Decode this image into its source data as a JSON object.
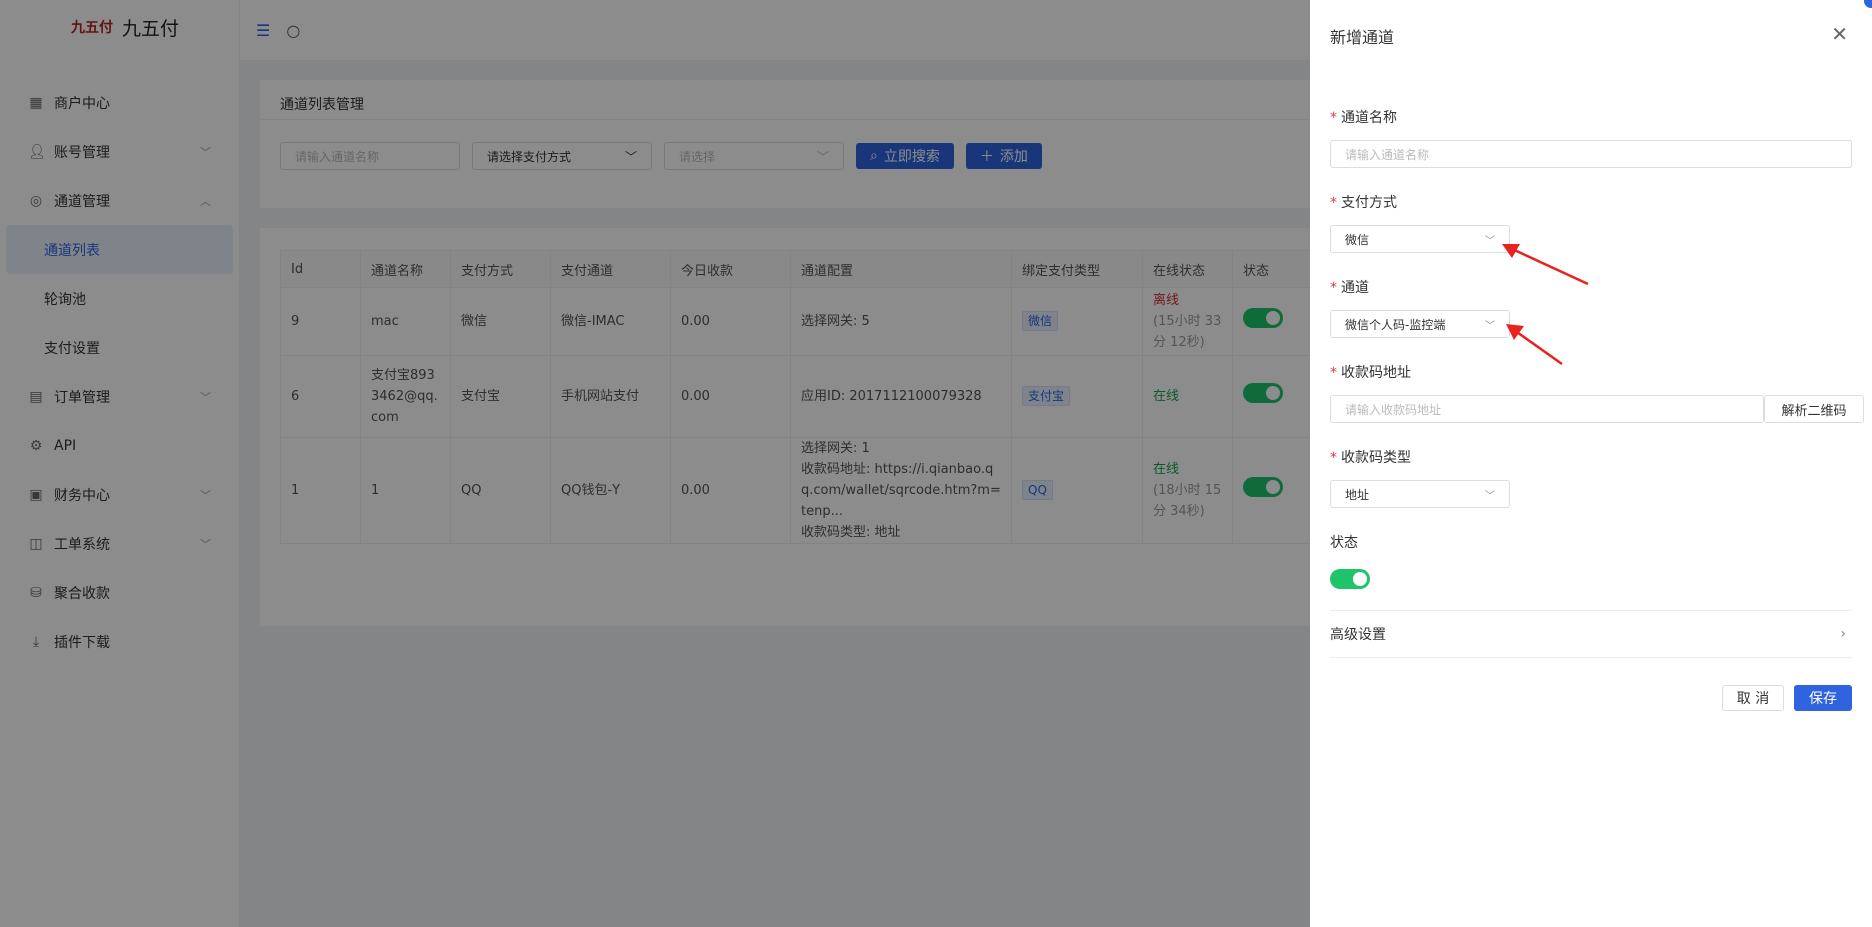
{
  "app": {
    "name": "九五付",
    "logo_text": "九五付"
  },
  "sidebar": {
    "items": [
      {
        "label": "商户中心",
        "icon": "grid-icon"
      },
      {
        "label": "账号管理",
        "icon": "user-icon",
        "has_children": true
      },
      {
        "label": "通道管理",
        "icon": "channel-icon",
        "has_children": true,
        "expanded": true
      },
      {
        "label": "通道列表",
        "sub": true,
        "active": true
      },
      {
        "label": "轮询池",
        "sub": true
      },
      {
        "label": "支付设置",
        "sub": true
      },
      {
        "label": "订单管理",
        "icon": "order-icon",
        "has_children": true
      },
      {
        "label": "API",
        "icon": "api-icon"
      },
      {
        "label": "财务中心",
        "icon": "finance-icon",
        "has_children": true
      },
      {
        "label": "工单系统",
        "icon": "ticket-icon",
        "has_children": true
      },
      {
        "label": "聚合收款",
        "icon": "aggregate-icon"
      },
      {
        "label": "插件下载",
        "icon": "download-icon"
      }
    ]
  },
  "main": {
    "title": "通道列表管理",
    "filters": {
      "name_placeholder": "请输入通道名称",
      "pay_method_placeholder": "请选择支付方式",
      "select_placeholder": "请选择",
      "search_label": "立即搜索",
      "add_label": "添加"
    },
    "table": {
      "columns": [
        "Id",
        "通道名称",
        "支付方式",
        "支付通道",
        "今日收款",
        "通道配置",
        "绑定支付类型",
        "在线状态",
        "状态"
      ],
      "rows": [
        {
          "id": "9",
          "name": "mac",
          "method": "微信",
          "channel": "微信-IMAC",
          "today": "0.00",
          "config": [
            "选择网关: 5"
          ],
          "bind_type": "微信",
          "status_text": "离线",
          "status_sub": "(15小时 33分 12秒)",
          "online": false
        },
        {
          "id": "6",
          "name": "支付宝8933462@qq.com",
          "method": "支付宝",
          "channel": "手机网站支付",
          "today": "0.00",
          "config": [
            "应用ID: 2017112100079328"
          ],
          "bind_type": "支付宝",
          "status_text": "在线",
          "status_sub": "",
          "online": true
        },
        {
          "id": "1",
          "name": "1",
          "method": "QQ",
          "channel": "QQ钱包-Y",
          "today": "0.00",
          "config": [
            "选择网关: 1",
            "收款码地址: https://i.qianbao.qq.com/wallet/sqrcode.htm?m=tenp...",
            "收款码类型: 地址"
          ],
          "bind_type": "QQ",
          "status_text": "在线",
          "status_sub": "(18小时 15分 34秒)",
          "online": true
        }
      ]
    }
  },
  "drawer": {
    "title": "新增通道",
    "fields": {
      "channel_name_label": "通道名称",
      "channel_name_placeholder": "请输入通道名称",
      "pay_method_label": "支付方式",
      "pay_method_value": "微信",
      "channel_label": "通道",
      "channel_value": "微信个人码-监控端",
      "qr_address_label": "收款码地址",
      "qr_address_placeholder": "请输入收款码地址",
      "parse_qr_label": "解析二维码",
      "qr_type_label": "收款码类型",
      "qr_type_value": "地址",
      "status_label": "状态",
      "status_on": true,
      "advanced_label": "高级设置"
    },
    "cancel_label": "取 消",
    "save_label": "保存"
  },
  "colors": {
    "accent": "#2f63e0",
    "toggle_on": "#1ec36a",
    "offline": "#d03030",
    "online": "#1aa34a",
    "annotation_arrow": "#e8231f"
  }
}
